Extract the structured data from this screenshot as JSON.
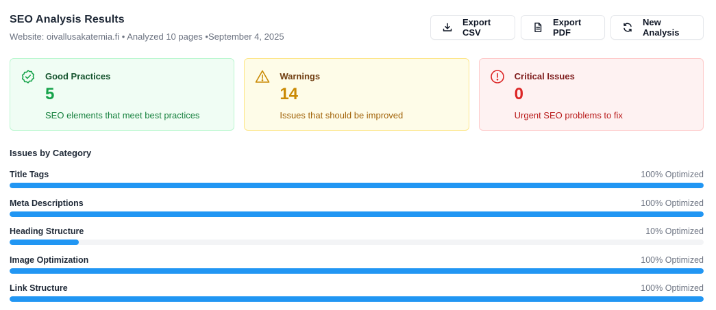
{
  "header": {
    "title": "SEO Analysis Results",
    "subtitle": "Website: oivallusakatemia.fi • Analyzed 10 pages •September 4, 2025"
  },
  "actions": [
    {
      "label": "Export CSV",
      "icon": "download-icon"
    },
    {
      "label": "Export PDF",
      "icon": "document-icon"
    },
    {
      "label": "New Analysis",
      "icon": "refresh-icon"
    }
  ],
  "cards": {
    "good": {
      "label": "Good Practices",
      "value": "5",
      "desc": "SEO elements that meet best practices",
      "icon": "check-badge-icon",
      "color": "#16a34a"
    },
    "warn": {
      "label": "Warnings",
      "value": "14",
      "desc": "Issues that should be improved",
      "icon": "warning-triangle-icon",
      "color": "#ca8a04"
    },
    "crit": {
      "label": "Critical Issues",
      "value": "0",
      "desc": "Urgent SEO problems to fix",
      "icon": "alert-circle-icon",
      "color": "#dc2626"
    }
  },
  "categories_title": "Issues by Category",
  "categories": [
    {
      "name": "Title Tags",
      "percent": 100,
      "status": "100% Optimized"
    },
    {
      "name": "Meta Descriptions",
      "percent": 100,
      "status": "100% Optimized"
    },
    {
      "name": "Heading Structure",
      "percent": 10,
      "status": "10% Optimized"
    },
    {
      "name": "Image Optimization",
      "percent": 100,
      "status": "100% Optimized"
    },
    {
      "name": "Link Structure",
      "percent": 100,
      "status": "100% Optimized"
    }
  ],
  "colors": {
    "bar_fill": "#2196f3",
    "bar_track": "#f3f4f6"
  }
}
